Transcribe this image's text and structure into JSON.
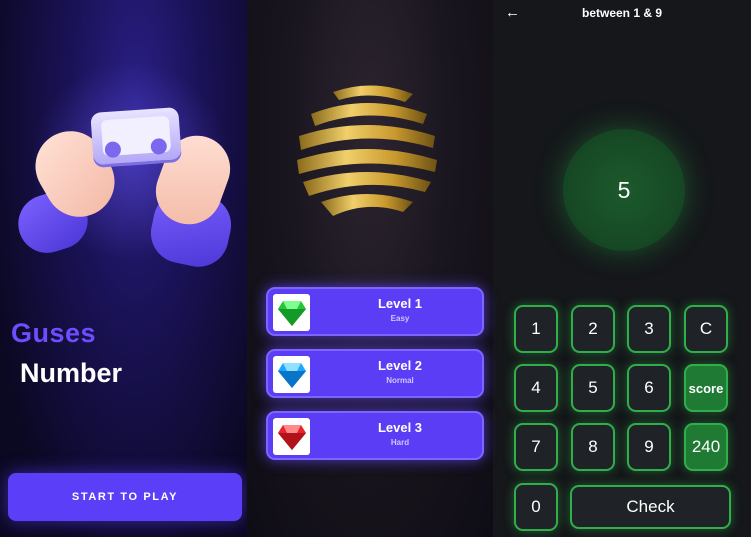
{
  "intro": {
    "title_line1": "Guses",
    "title_line2": "Number",
    "start_label": "START TO PLAY"
  },
  "levels": [
    {
      "title": "Level 1",
      "difficulty": "Easy",
      "gem": "green-gem-icon"
    },
    {
      "title": "Level 2",
      "difficulty": "Normal",
      "gem": "blue-gem-icon"
    },
    {
      "title": "Level 3",
      "difficulty": "Hard",
      "gem": "red-gem-icon"
    }
  ],
  "game": {
    "back_icon": "arrow-left-icon",
    "title": "between 1 & 9",
    "current_guess": "5",
    "keys": [
      "1",
      "2",
      "3",
      "C",
      "4",
      "5",
      "6",
      "7",
      "8",
      "9",
      "0"
    ],
    "score_label": "score",
    "score_value": "240",
    "check_label": "Check"
  },
  "colors": {
    "accent_purple": "#5b3ef7",
    "accent_green": "#2fae4a"
  }
}
